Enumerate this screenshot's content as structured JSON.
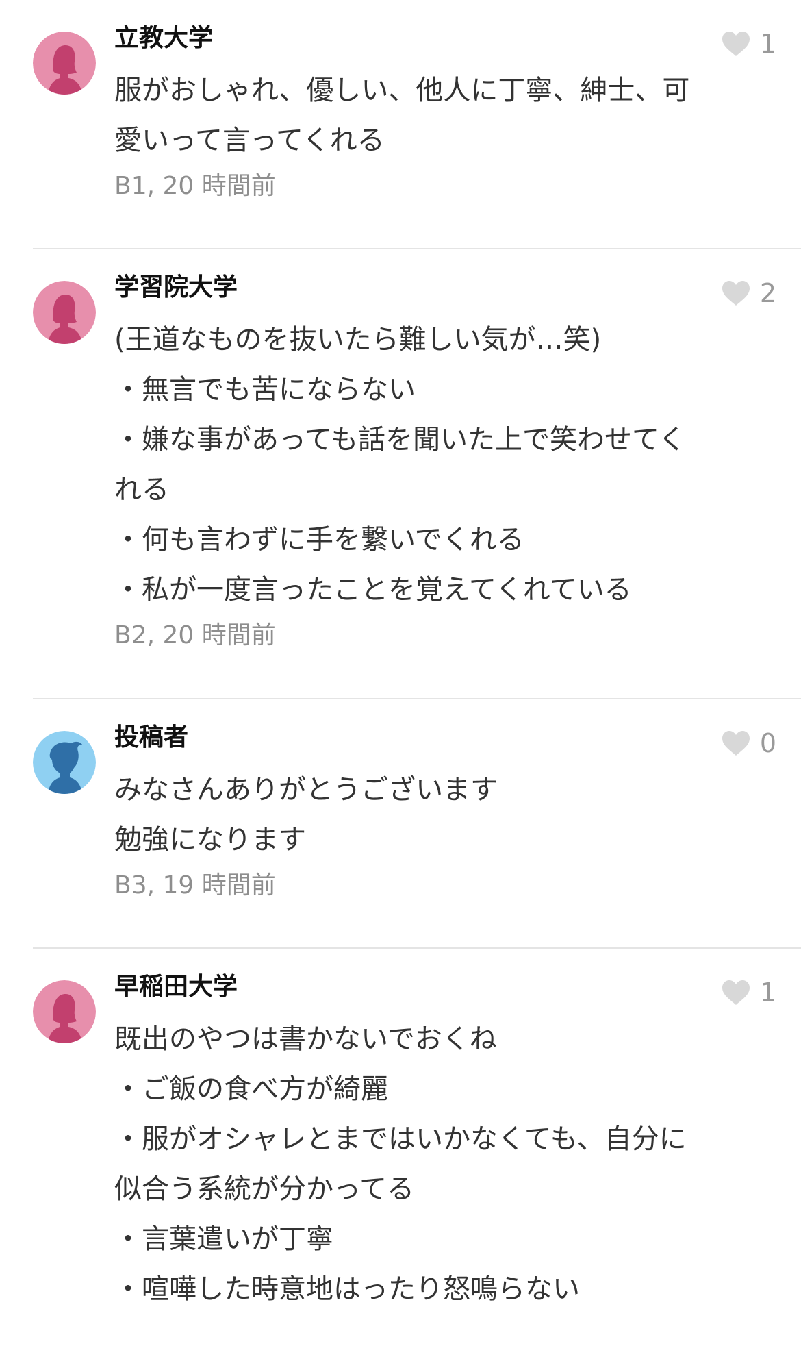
{
  "colors": {
    "female_avatar_bg": "#e78fac",
    "female_avatar_fg": "#c2406e",
    "male_avatar_bg": "#8fd0f2",
    "male_avatar_fg": "#2f6fa7",
    "heart": "#d8d8d8",
    "meta_text": "#8e8e8e"
  },
  "comments": [
    {
      "author": "立教大学",
      "avatar": "female-avatar-icon",
      "likes": "1",
      "lines": [
        "服がおしゃれ、優しい、他人に丁寧、紳士、可",
        "愛いって言ってくれる"
      ],
      "meta": "B1, 20 時間前"
    },
    {
      "author": "学習院大学",
      "avatar": "female-avatar-icon",
      "likes": "2",
      "lines": [
        "(王道なものを抜いたら難しい気が…笑)",
        "・無言でも苦にならない",
        "・嫌な事があっても話を聞いた上で笑わせてく",
        "れる",
        "・何も言わずに手を繋いでくれる",
        "・私が一度言ったことを覚えてくれている"
      ],
      "meta": "B2, 20 時間前"
    },
    {
      "author": "投稿者",
      "avatar": "male-avatar-icon",
      "likes": "0",
      "lines": [
        "みなさんありがとうございます",
        "勉強になります"
      ],
      "meta": "B3, 19 時間前"
    },
    {
      "author": "早稲田大学",
      "avatar": "female-avatar-icon",
      "likes": "1",
      "lines": [
        "既出のやつは書かないでおくね",
        "・ご飯の食べ方が綺麗",
        "・服がオシャレとまではいかなくても、自分に",
        "似合う系統が分かってる",
        "・言葉遣いが丁寧",
        "・喧嘩した時意地はったり怒鳴らない"
      ],
      "meta": ""
    }
  ]
}
